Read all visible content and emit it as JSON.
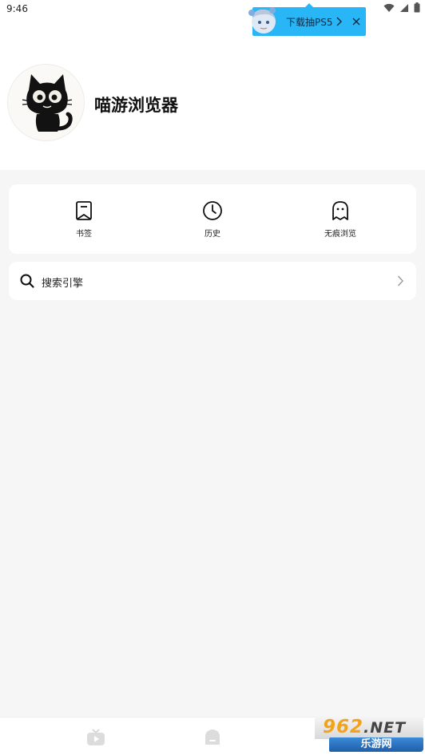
{
  "status_bar": {
    "time": "9:46"
  },
  "ad_banner": {
    "text": "下载抽PS5"
  },
  "profile": {
    "app_title": "喵游浏览器"
  },
  "quick_actions": [
    {
      "label": "书签",
      "icon": "bookmark-icon"
    },
    {
      "label": "历史",
      "icon": "clock-icon"
    },
    {
      "label": "无痕浏览",
      "icon": "ghost-icon"
    }
  ],
  "search_engine": {
    "label": "搜索引擎"
  },
  "bottom_nav": [
    {
      "icon": "video-icon"
    },
    {
      "icon": "home-icon"
    }
  ],
  "watermark": {
    "logo": "962",
    "suffix": ".NET",
    "caption": "乐游网"
  },
  "colors": {
    "accent": "#29b6f6",
    "background": "#f6f6f6",
    "card": "#ffffff"
  }
}
